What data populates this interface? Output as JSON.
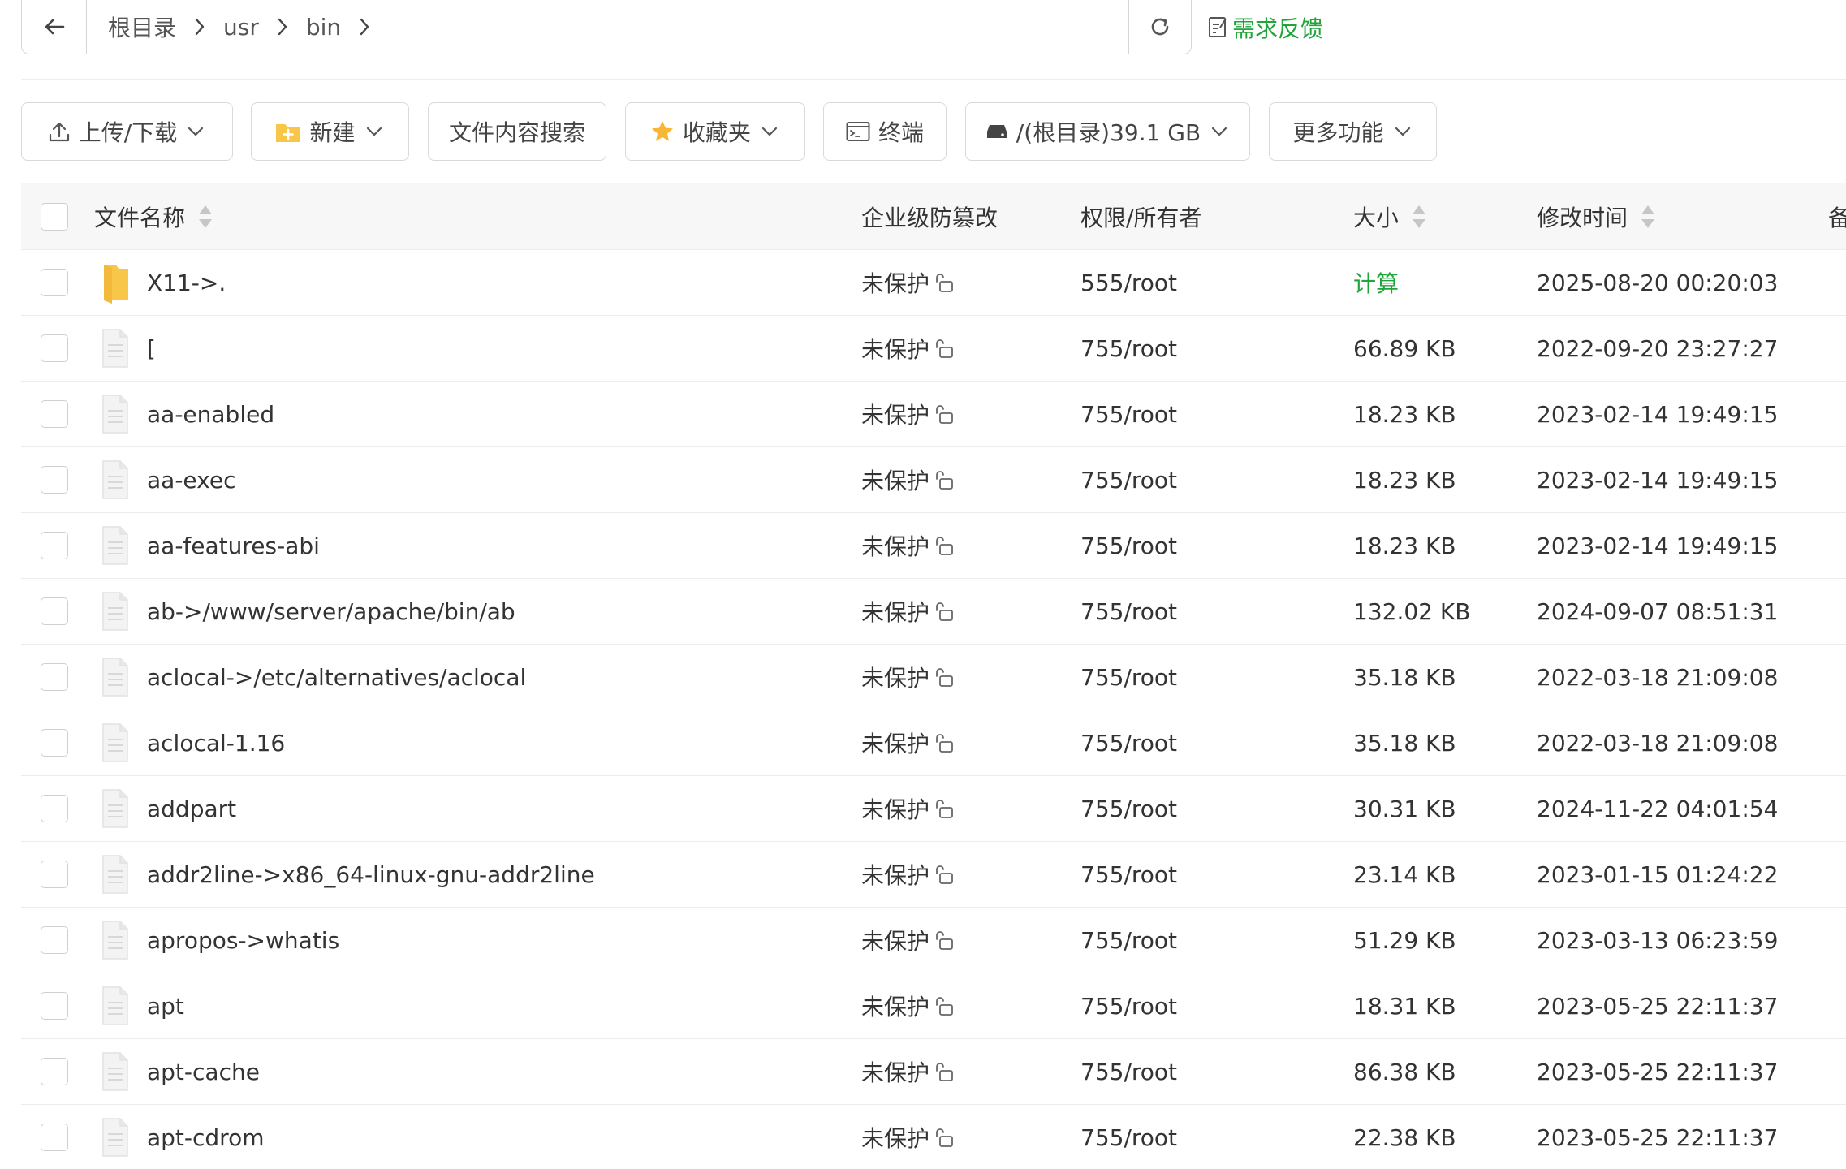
{
  "breadcrumb": [
    "根目录",
    "usr",
    "bin"
  ],
  "feedback_label": "需求反馈",
  "toolbar": {
    "upload": "上传/下载",
    "new": "新建",
    "search": "文件内容搜索",
    "favorites": "收藏夹",
    "terminal": "终端",
    "disk": "/(根目录)39.1 GB",
    "more": "更多功能"
  },
  "columns": {
    "name": "文件名称",
    "tamper": "企业级防篡改",
    "perm": "权限/所有者",
    "size": "大小",
    "mtime": "修改时间",
    "note": "备"
  },
  "colors": {
    "accent": "#20a53a",
    "folder": "#f8c749"
  },
  "files": [
    {
      "name": "X11->.",
      "icon": "folder-icon",
      "tamper": "未保护",
      "perm": "555/root",
      "size": "计算",
      "mtime": "2025-08-20 00:20:03"
    },
    {
      "name": "[",
      "icon": "file-icon",
      "tamper": "未保护",
      "perm": "755/root",
      "size": "66.89 KB",
      "mtime": "2022-09-20 23:27:27"
    },
    {
      "name": "aa-enabled",
      "icon": "file-icon",
      "tamper": "未保护",
      "perm": "755/root",
      "size": "18.23 KB",
      "mtime": "2023-02-14 19:49:15"
    },
    {
      "name": "aa-exec",
      "icon": "file-icon",
      "tamper": "未保护",
      "perm": "755/root",
      "size": "18.23 KB",
      "mtime": "2023-02-14 19:49:15"
    },
    {
      "name": "aa-features-abi",
      "icon": "file-icon",
      "tamper": "未保护",
      "perm": "755/root",
      "size": "18.23 KB",
      "mtime": "2023-02-14 19:49:15"
    },
    {
      "name": "ab->/www/server/apache/bin/ab",
      "icon": "file-icon",
      "tamper": "未保护",
      "perm": "755/root",
      "size": "132.02 KB",
      "mtime": "2024-09-07 08:51:31"
    },
    {
      "name": "aclocal->/etc/alternatives/aclocal",
      "icon": "file-icon",
      "tamper": "未保护",
      "perm": "755/root",
      "size": "35.18 KB",
      "mtime": "2022-03-18 21:09:08"
    },
    {
      "name": "aclocal-1.16",
      "icon": "file-icon",
      "tamper": "未保护",
      "perm": "755/root",
      "size": "35.18 KB",
      "mtime": "2022-03-18 21:09:08"
    },
    {
      "name": "addpart",
      "icon": "file-icon",
      "tamper": "未保护",
      "perm": "755/root",
      "size": "30.31 KB",
      "mtime": "2024-11-22 04:01:54"
    },
    {
      "name": "addr2line->x86_64-linux-gnu-addr2line",
      "icon": "file-icon",
      "tamper": "未保护",
      "perm": "755/root",
      "size": "23.14 KB",
      "mtime": "2023-01-15 01:24:22"
    },
    {
      "name": "apropos->whatis",
      "icon": "file-icon",
      "tamper": "未保护",
      "perm": "755/root",
      "size": "51.29 KB",
      "mtime": "2023-03-13 06:23:59"
    },
    {
      "name": "apt",
      "icon": "file-icon",
      "tamper": "未保护",
      "perm": "755/root",
      "size": "18.31 KB",
      "mtime": "2023-05-25 22:11:37"
    },
    {
      "name": "apt-cache",
      "icon": "file-icon",
      "tamper": "未保护",
      "perm": "755/root",
      "size": "86.38 KB",
      "mtime": "2023-05-25 22:11:37"
    },
    {
      "name": "apt-cdrom",
      "icon": "file-icon",
      "tamper": "未保护",
      "perm": "755/root",
      "size": "22.38 KB",
      "mtime": "2023-05-25 22:11:37"
    }
  ]
}
